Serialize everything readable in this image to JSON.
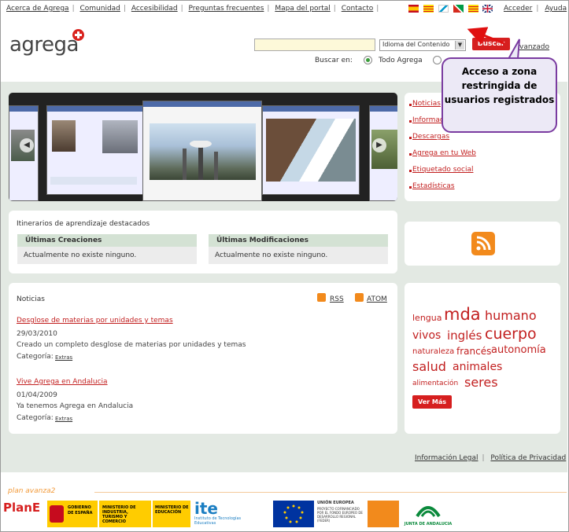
{
  "topnav": {
    "links": [
      "Acerca de Agrega",
      "Comunidad",
      "Accesibilidad",
      "Preguntas frecuentes",
      "Mapa del portal",
      "Contacto"
    ]
  },
  "rightnav": {
    "acceder": "Acceder",
    "ayuda": "Ayuda"
  },
  "logo": {
    "text": "agrega"
  },
  "search": {
    "language_select": "Idioma del Contenido",
    "button": "Buscar",
    "advanced_link": "vanzado",
    "search_in_label": "Buscar en:",
    "option_all": "Todo Agrega"
  },
  "side_links": [
    "Noticias",
    "Información",
    "Descargas",
    "Agrega en tu Web",
    "Etiquetado social",
    "Estadísticas"
  ],
  "itinerarios": {
    "title": "Itinerarios de aprendizaje destacados",
    "col1": {
      "header": "Últimas Creaciones",
      "body": "Actualmente no existe ninguno."
    },
    "col2": {
      "header": "Últimas Modificaciones",
      "body": "Actualmente no existe ninguno."
    }
  },
  "noticias": {
    "title": "Noticias",
    "rss": "RSS",
    "atom": "ATOM",
    "items": [
      {
        "title": "Desglose de materias por unidades y temas",
        "date": "29/03/2010",
        "text": "Creado un completo desglose de materias por unidades y temas",
        "category_label": "Categoría:",
        "category": "Extras"
      },
      {
        "title": "Vive Agrega en Andalucia",
        "date": "01/04/2009",
        "text": "Ya tenemos Agrega en Andalucia",
        "category_label": "Categoría:",
        "category": "Extras"
      }
    ]
  },
  "tags": {
    "items": [
      "lengua",
      "mda",
      "humano",
      "vivos",
      "inglés",
      "cuerpo",
      "naturaleza",
      "francés",
      "autonomía",
      "salud",
      "animales",
      "alimentación",
      "seres"
    ],
    "more": "Ver Más"
  },
  "footer": {
    "legal": "Información Legal",
    "privacy": "Política de Privacidad"
  },
  "plan": {
    "label": "plan avanza2"
  },
  "sponsors": {
    "plane": "PlanE",
    "gobierno": "GOBIERNO DE ESPAÑA",
    "industria": "MINISTERIO DE INDUSTRIA, TURISMO Y COMERCIO",
    "educacion": "MINISTERIO DE EDUCACIÓN",
    "ite": "ite",
    "ite_sub": "Instituto de Tecnologías Educativas",
    "ue": "UNIÓN EUROPEA",
    "feder": "PROYECTO COFINANCIADO POR EL FONDO EUROPEO DE DESARROLLO REGIONAL (FEDER)",
    "junta": "JUNTA DE ANDALUCIA"
  },
  "callout": {
    "text": "Acceso a zona restringida de usuarios registrados"
  },
  "colors": {
    "accent": "#d61f1f",
    "callout_border": "#7a3ba0",
    "band": "#e3e9e3"
  }
}
